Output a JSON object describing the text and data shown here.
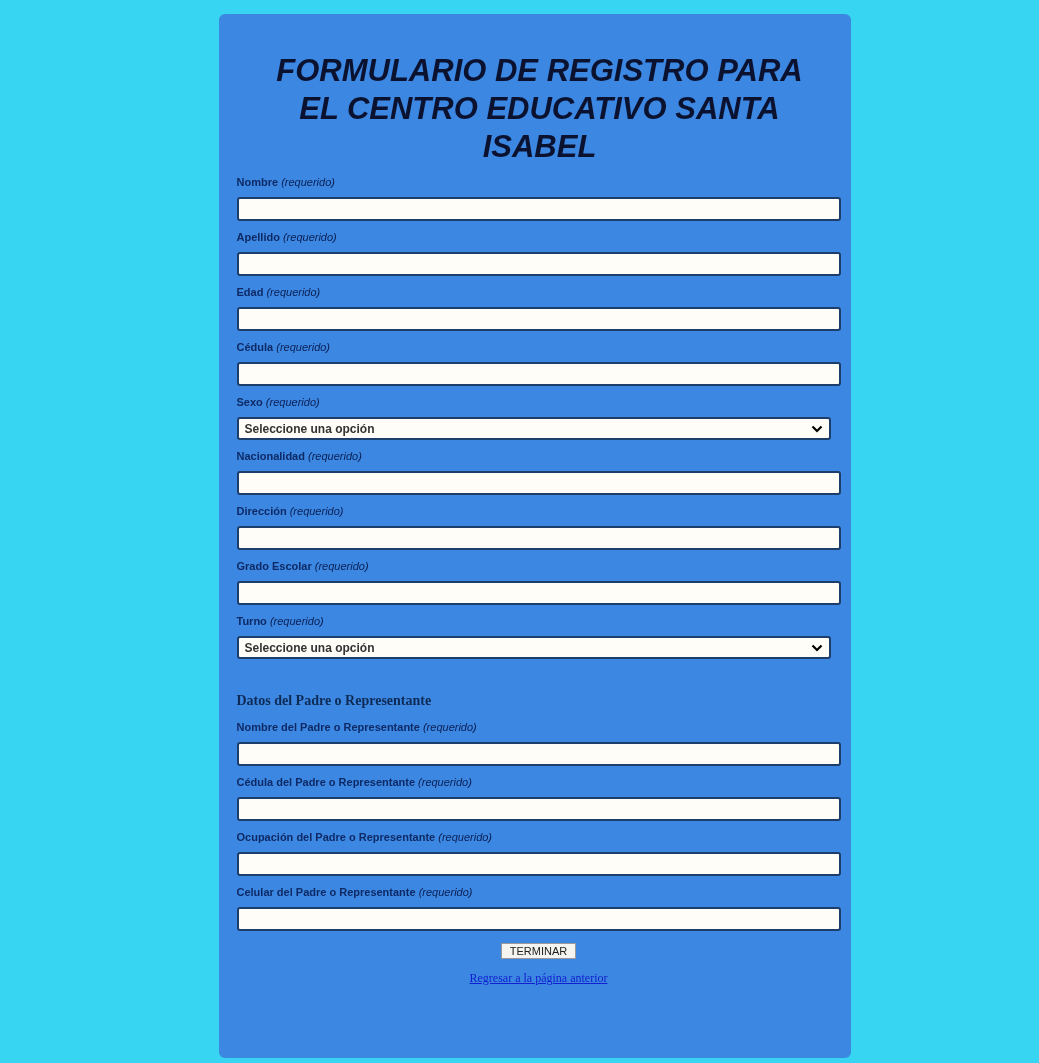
{
  "title": "FORMULARIO DE REGISTRO PARA EL CENTRO EDUCATIVO SANTA ISABEL",
  "student_fields": [
    {
      "label": "Nombre",
      "hint": "(requerido)",
      "kind": "text"
    },
    {
      "label": "Apellido",
      "hint": "(requerido)",
      "kind": "text"
    },
    {
      "label": "Edad",
      "hint": "(requerido)",
      "kind": "text"
    },
    {
      "label": "Cédula",
      "hint": "(requerido)",
      "kind": "text"
    },
    {
      "label": "Sexo",
      "hint": "(requerido)",
      "kind": "select",
      "value": "Seleccione una opción"
    },
    {
      "label": "Nacionalidad",
      "hint": "(requerido)",
      "kind": "text"
    },
    {
      "label": "Dirección",
      "hint": "(requerido)",
      "kind": "text"
    },
    {
      "label": "Grado Escolar",
      "hint": "(requerido)",
      "kind": "text"
    },
    {
      "label": "Turno",
      "hint": "(requerido)",
      "kind": "select",
      "value": "Seleccione una opción"
    }
  ],
  "section_heading": "Datos del Padre o Representante",
  "parent_fields": [
    {
      "label": "Nombre del Padre o Representante",
      "hint": "(requerido)",
      "kind": "text"
    },
    {
      "label": "Cédula del Padre o Representante",
      "hint": "(requerido)",
      "kind": "text"
    },
    {
      "label": "Ocupación del Padre o Representante",
      "hint": "(requerido)",
      "kind": "text"
    },
    {
      "label": "Celular del Padre o Representante",
      "hint": "(requerido)",
      "kind": "text"
    }
  ],
  "submit_button": "TERMINAR",
  "back_link": "Regresar a la página anterior"
}
